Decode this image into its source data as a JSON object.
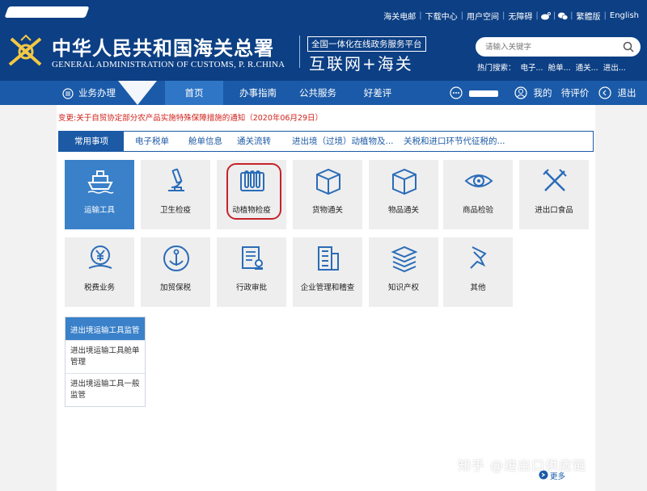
{
  "header": {
    "top_links": [
      "海关电邮",
      "下载中心",
      "用户空间",
      "无障碍",
      "繁體版",
      "English"
    ],
    "title_cn": "中华人民共和国海关总署",
    "title_en": "GENERAL ADMINISTRATION OF CUSTOMS, P. R.CHINA",
    "platform_small": "全国一体化在线政务服务平台",
    "platform_big": "互联网+海关",
    "search_placeholder": "请输入关键字",
    "hot_label": "热门搜索：",
    "hot_items": [
      "电子...",
      "舱单...",
      "通关...",
      "进出..."
    ]
  },
  "nav": {
    "items": [
      "业务办理",
      "首页",
      "办事指南",
      "公共服务",
      "好差评"
    ],
    "right": [
      "我的",
      "待评价(0)",
      "退出"
    ]
  },
  "notice": "变更:关于自贸协定部分农产品实施特殊保障措施的通知（2020年06月29日）",
  "tabs": [
    "常用事项",
    "电子税单",
    "舱单信息",
    "通关流转",
    "进出境（过境）动植物及...",
    "关税和进口环节代征税的..."
  ],
  "tiles": [
    "运输工具",
    "卫生检疫",
    "动植物检疫",
    "货物通关",
    "物品通关",
    "商品检验",
    "进出口食品",
    "税费业务",
    "加贸保税",
    "行政审批",
    "企业管理和稽查",
    "知识产权",
    "其他"
  ],
  "submenu": {
    "title": "进出境运输工具监管",
    "items": [
      "进出境运输工具舱单管理",
      "进出境运输工具一般监管"
    ]
  },
  "more": "更多",
  "watermark": "知乎 @进出口供应链"
}
